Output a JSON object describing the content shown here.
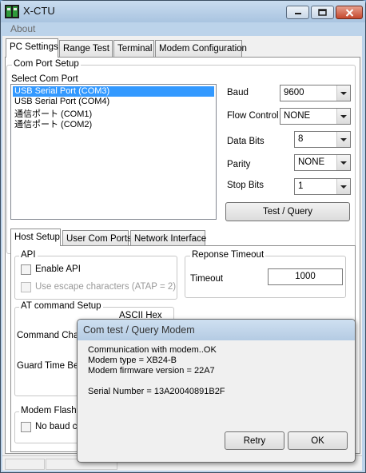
{
  "window": {
    "title": "X-CTU",
    "app_icon": "xctu-app-icon",
    "caption_buttons": {
      "minimize": "minimize-icon",
      "maximize": "maximize-icon",
      "close": "close-icon"
    }
  },
  "menu": {
    "about": "About"
  },
  "main_tabs": [
    {
      "label": "PC Settings",
      "active": true
    },
    {
      "label": "Range Test",
      "active": false
    },
    {
      "label": "Terminal",
      "active": false
    },
    {
      "label": "Modem Configuration",
      "active": false
    }
  ],
  "com_port_setup": {
    "group_label": "Com Port Setup",
    "select_label": "Select Com Port",
    "ports": [
      {
        "label": "USB Serial Port (COM3)",
        "selected": true
      },
      {
        "label": "USB Serial Port (COM4)",
        "selected": false
      },
      {
        "label": "通信ポート (COM1)",
        "selected": false
      },
      {
        "label": "通信ポート (COM2)",
        "selected": false
      }
    ],
    "baud": {
      "label": "Baud",
      "value": "9600"
    },
    "flow_control": {
      "label": "Flow Control",
      "value": "NONE"
    },
    "data_bits": {
      "label": "Data Bits",
      "value": "8"
    },
    "parity": {
      "label": "Parity",
      "value": "NONE"
    },
    "stop_bits": {
      "label": "Stop Bits",
      "value": "1"
    },
    "test_button": "Test  / Query"
  },
  "sub_tabs": [
    {
      "label": "Host Setup",
      "active": true
    },
    {
      "label": "User Com Ports",
      "active": false
    },
    {
      "label": "Network Interface",
      "active": false
    }
  ],
  "api": {
    "group_label": "API",
    "enable_api": "Enable API",
    "escape_chars": "Use escape characters (ATAP = 2)"
  },
  "response_timeout": {
    "group_label": "Reponse Timeout",
    "timeout_label": "Timeout",
    "timeout_value": "1000"
  },
  "at_command": {
    "group_label": "AT command Setup",
    "header": "ASCII   Hex",
    "command_char_label": "Command Chara",
    "guard_time_label": "Guard Time Bef"
  },
  "modem_flash": {
    "group_label": "Modem Flash U",
    "no_baud_label": "No baud c"
  },
  "dialog": {
    "title": "Com test / Query Modem",
    "lines": [
      "Communication with modem..OK",
      "Modem type = XB24-B",
      "Modem firmware version = 22A7",
      "Serial Number = 13A20040891B2F"
    ],
    "retry_button": "Retry",
    "ok_button": "OK"
  },
  "colors": {
    "selection": "#3399ff",
    "window_frame": "#bcd3ea"
  }
}
